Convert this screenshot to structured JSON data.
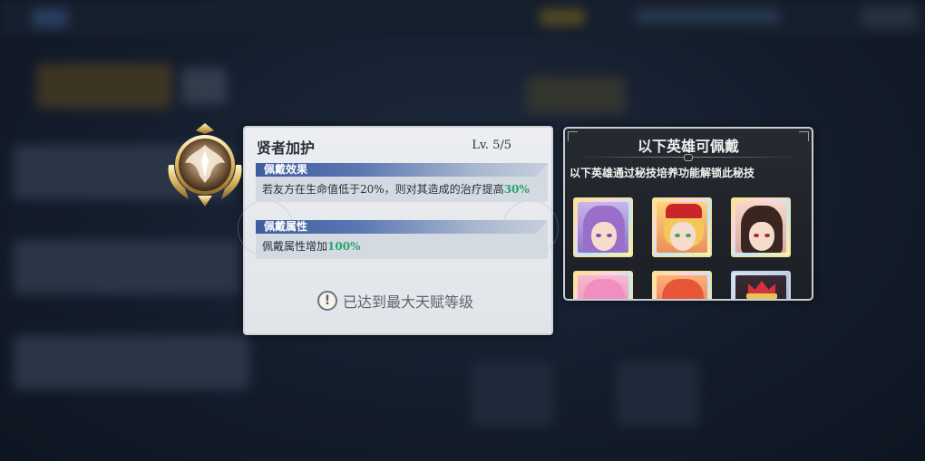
{
  "skill": {
    "name": "贤者加护",
    "level": "Lv.  5/5",
    "effect_header": "佩戴效果",
    "effect_text_before": "若友方在生命值低于20%，则对其造成的治疗提高",
    "effect_value": "30%",
    "attr_header": "佩戴属性",
    "attr_text_before": "佩戴属性增加",
    "attr_value": "100%",
    "max_icon": "!",
    "max_note": "已达到最大天赋等级"
  },
  "heroes_panel": {
    "title": "以下英雄可佩戴",
    "subtitle": "以下英雄通过秘技培养功能解锁此秘技",
    "heroes": [
      {
        "name": "hero-purple-hair"
      },
      {
        "name": "hero-red-hat"
      },
      {
        "name": "hero-dark-hair"
      },
      {
        "name": "hero-pink-hair"
      },
      {
        "name": "hero-red-hair"
      },
      {
        "name": "hero-crown"
      }
    ]
  },
  "colors": {
    "highlight": "#2aa36f",
    "section_header": "#3f5d9c",
    "panel_dark": "#262a31"
  }
}
